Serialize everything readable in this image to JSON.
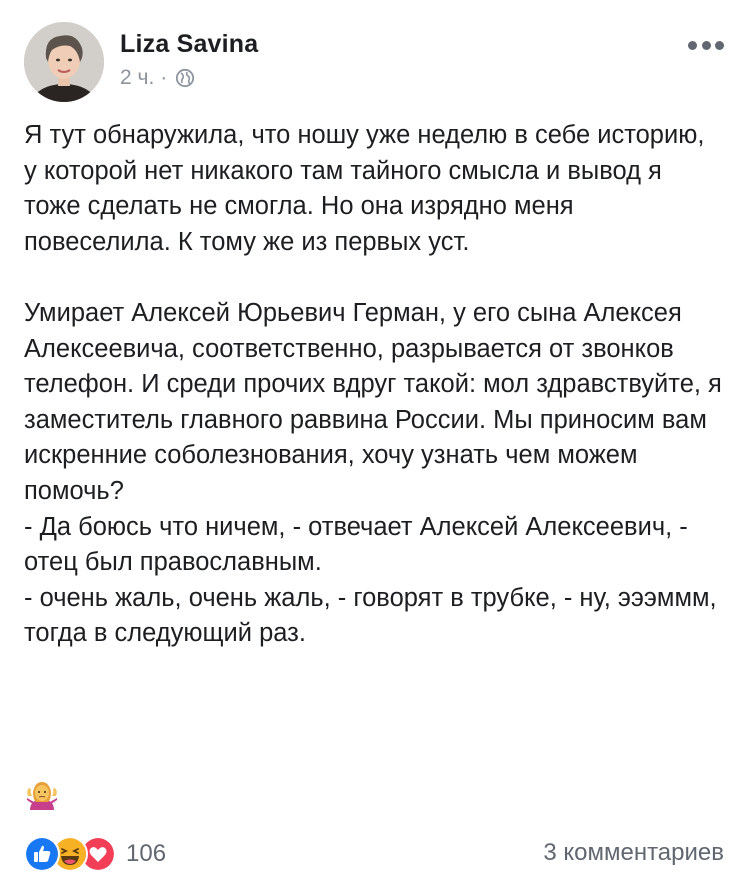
{
  "post": {
    "author": "Liza Savina",
    "time": "2 ч.",
    "separator": "·",
    "privacy_icon": "globe-icon",
    "more_icon": "more-options-icon",
    "paragraphs": [
      "Я тут обнаружила, что ношу уже неделю в себе историю, у которой нет никакого там тайного смысла и вывод я тоже сделать не смогла. Но она изрядно меня повеселила. К тому же из первых уст.",
      "Умирает Алексей Юрьевич Герман, у его сына Алексея Алексеевича, соответственно, разрывается от звонков телефон. И среди прочих вдруг такой: мол здравствуйте, я заместитель главного раввина России. Мы приносим вам искренние соболезнования, хочу узнать чем можем помочь?",
      "- Да боюсь что ничем, - отвечает Алексей Алексеевич, - отец был православным.",
      "- очень жаль, очень жаль, - говорят в трубке, - ну, эээммм, тогда в следующий раз."
    ],
    "trailing_emoji": "person-shrugging-emoji"
  },
  "footer": {
    "reactions": [
      "like-reaction-icon",
      "haha-reaction-icon",
      "love-reaction-icon"
    ],
    "reaction_count": "106",
    "comments_label": "3 комментариев"
  },
  "colors": {
    "like": "#1877f2",
    "love": "#f33e58",
    "haha": "#f7b125",
    "secondary_text": "#8d949e",
    "primary_text": "#1c1e21"
  }
}
